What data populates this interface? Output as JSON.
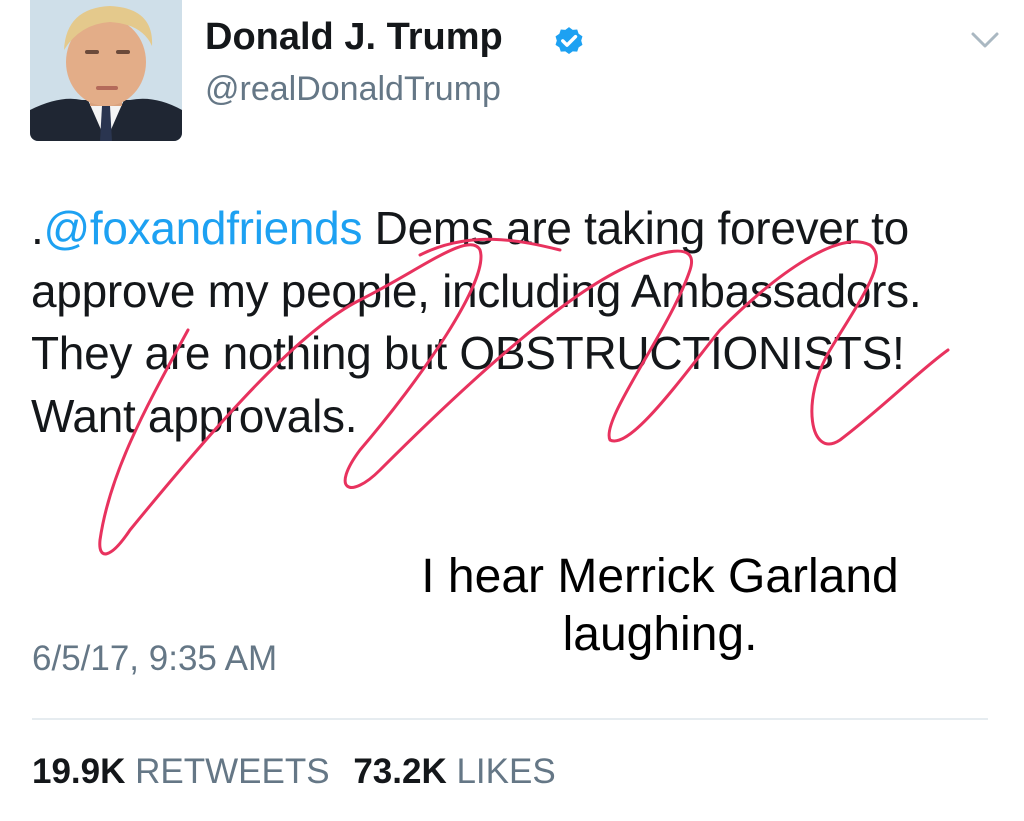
{
  "author": {
    "display_name": "Donald J. Trump",
    "handle": "@realDonaldTrump",
    "verified": true,
    "avatar_icon": "profile-photo"
  },
  "tweet": {
    "prefix": ".",
    "mention": "@foxandfriends",
    "body": " Dems are taking forever to approve my people, including Ambassadors. They are nothing but OBSTRUCTIONISTS! Want approvals.",
    "timestamp": "6/5/17, 9:35 AM"
  },
  "annotation": {
    "text": "I hear Merrick Garland laughing."
  },
  "stats": {
    "retweets_count": "19.9K",
    "retweets_label": "RETWEETS",
    "likes_count": "73.2K",
    "likes_label": "LIKES"
  },
  "colors": {
    "link": "#1da1f2",
    "secondary_text": "#657786",
    "scribble": "#e8325e",
    "verified": "#1da1f2"
  },
  "icons": {
    "verified": "verified-badge-icon",
    "menu": "chevron-down-icon"
  }
}
